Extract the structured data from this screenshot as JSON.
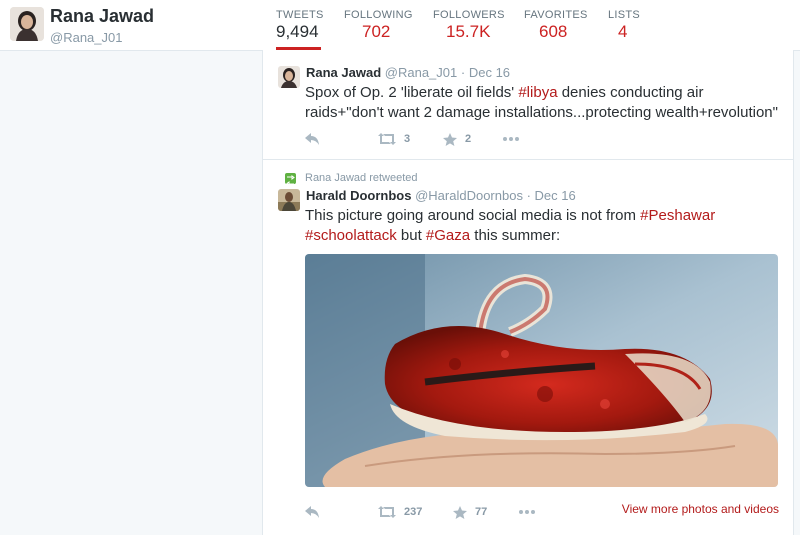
{
  "profile": {
    "name": "Rana Jawad",
    "handle": "@Rana_J01"
  },
  "stats": [
    {
      "label": "TWEETS",
      "value": "9,494",
      "active": true
    },
    {
      "label": "FOLLOWING",
      "value": "702"
    },
    {
      "label": "FOLLOWERS",
      "value": "15.7K"
    },
    {
      "label": "FAVORITES",
      "value": "608"
    },
    {
      "label": "LISTS",
      "value": "4"
    }
  ],
  "tweets": [
    {
      "name": "Rana Jawad",
      "handle": "@Rana_J01",
      "date": "Dec 16",
      "text_before": "Spox of Op. 2 'liberate oil fields' ",
      "hashtag1": "#libya",
      "text_after": " denies conducting air raids+\"don't want 2 damage installations...protecting wealth+revolution\"",
      "retweets": "3",
      "favorites": "2"
    },
    {
      "retweeted_by": "Rana Jawad retweeted",
      "name": "Harald Doornbos",
      "handle": "@HaraldDoornbos",
      "date": "Dec 16",
      "text_before": "This picture going around social media is not from ",
      "hashtag1": "#Peshawar",
      "hashtag2": "#schoolattack",
      "text_mid": " but ",
      "hashtag3": "#Gaza",
      "text_after": " this summer:",
      "retweets": "237",
      "favorites": "77",
      "view_more": "View more photos and videos"
    }
  ],
  "colors": {
    "accent": "#cc2222",
    "link": "#b31b1b",
    "muted": "#8899a6",
    "retweet": "#5fb142"
  },
  "icons": [
    "reply-icon",
    "retweet-icon",
    "favorite-icon",
    "more-icon"
  ]
}
